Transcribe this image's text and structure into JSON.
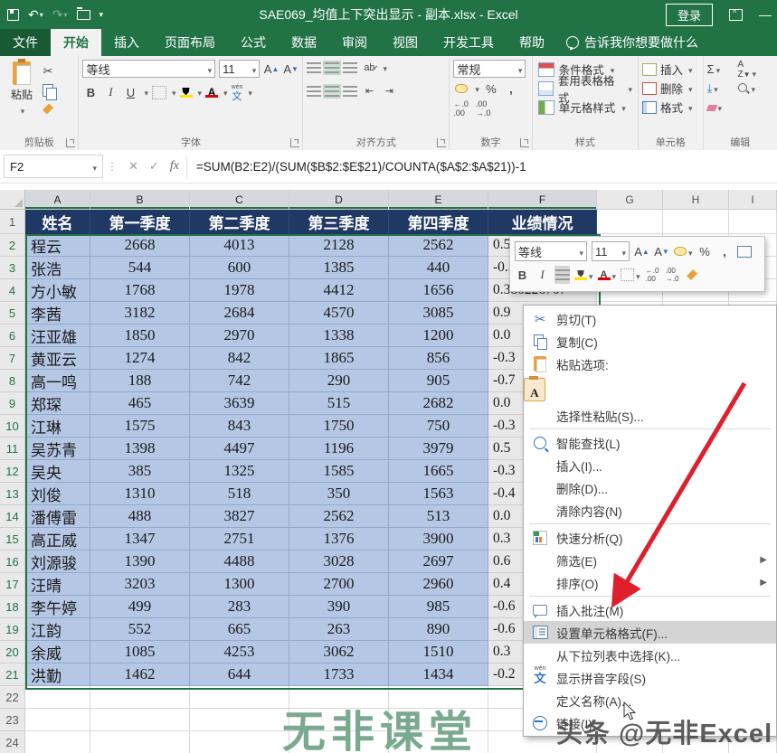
{
  "title_bar": {
    "title": "SAE069_均值上下突出显示 - 副本.xlsx  -  Excel",
    "login_label": "登录"
  },
  "tabs": {
    "items": [
      "文件",
      "开始",
      "插入",
      "页面布局",
      "公式",
      "数据",
      "审阅",
      "视图",
      "开发工具",
      "帮助"
    ],
    "active": "开始",
    "tell_me": "告诉我你想要做什么"
  },
  "ribbon": {
    "paste": "粘贴",
    "clipboard_group": "剪贴板",
    "font_group": "字体",
    "font_name": "等线",
    "font_size": "11",
    "bold": "B",
    "italic": "I",
    "underline": "U",
    "wen": "文",
    "align_group": "对齐方式",
    "number_group": "数字",
    "number_format": "常规",
    "percent": "%",
    "comma": ",",
    "styles_group": "样式",
    "cond_format": "条件格式",
    "table_format": "套用表格格式",
    "cell_styles": "单元格样式",
    "cells_group": "单元格",
    "insert": "插入",
    "delete": "删除",
    "format": "格式",
    "edit_group": "编辑",
    "sigma": "Σ"
  },
  "formula_bar": {
    "cell_ref": "F2",
    "formula": "=SUM(B2:E2)/(SUM($B$2:$E$21)/COUNTA($A$2:$A$21))-1"
  },
  "grid": {
    "column_letters": [
      "A",
      "B",
      "C",
      "D",
      "E",
      "F",
      "G",
      "H",
      "I"
    ],
    "headers": [
      "姓名",
      "第一季度",
      "第二季度",
      "第三季度",
      "第四季度",
      "业绩情况"
    ],
    "rows": [
      [
        "程云",
        "2668",
        "4013",
        "2128",
        "2562",
        "0.5"
      ],
      [
        "张浩",
        "544",
        "600",
        "1385",
        "440",
        "-0.5"
      ],
      [
        "方小敏",
        "1768",
        "1978",
        "4412",
        "1656",
        "0.380226707"
      ],
      [
        "李茜",
        "3182",
        "2684",
        "4570",
        "3085",
        "0.9"
      ],
      [
        "汪亚雄",
        "1850",
        "2970",
        "1338",
        "1200",
        "0.0"
      ],
      [
        "黄亚云",
        "1274",
        "842",
        "1865",
        "856",
        "-0.3"
      ],
      [
        "高一鸣",
        "188",
        "742",
        "290",
        "905",
        "-0.7"
      ],
      [
        "郑琛",
        "465",
        "3639",
        "515",
        "2682",
        "0.0"
      ],
      [
        "江琳",
        "1575",
        "843",
        "1750",
        "750",
        "-0.3"
      ],
      [
        "吴苏青",
        "1398",
        "4497",
        "1196",
        "3979",
        "0.5"
      ],
      [
        "吴央",
        "385",
        "1325",
        "1585",
        "1665",
        "-0.3"
      ],
      [
        "刘俊",
        "1310",
        "518",
        "350",
        "1563",
        "-0.4"
      ],
      [
        "潘傅雷",
        "488",
        "3827",
        "2562",
        "513",
        "0.0"
      ],
      [
        "高正威",
        "1347",
        "2751",
        "1376",
        "3900",
        "0.3"
      ],
      [
        "刘源骏",
        "1390",
        "4488",
        "3028",
        "2697",
        "0.6"
      ],
      [
        "汪晴",
        "3203",
        "1300",
        "2700",
        "2960",
        "0.4"
      ],
      [
        "李午婷",
        "499",
        "283",
        "390",
        "985",
        "-0.6"
      ],
      [
        "江韵",
        "552",
        "665",
        "263",
        "890",
        "-0.6"
      ],
      [
        "余威",
        "1085",
        "4253",
        "3062",
        "1510",
        "0.3"
      ],
      [
        "洪勤",
        "1462",
        "644",
        "1733",
        "1434",
        "-0.2"
      ]
    ]
  },
  "mini_toolbar": {
    "font_name": "等线",
    "font_size": "11",
    "bold": "B",
    "italic": "I",
    "font_color": "A",
    "percent": "%",
    "comma": ","
  },
  "context_menu": {
    "items": [
      {
        "icon": "scissors",
        "label": "剪切(T)"
      },
      {
        "icon": "copy",
        "label": "复制(C)"
      },
      {
        "icon": "paste",
        "label": "粘贴选项:"
      },
      {
        "type": "paste-option",
        "label": "A"
      },
      {
        "icon": "",
        "label": "选择性粘贴(S)..."
      },
      {
        "type": "separator"
      },
      {
        "icon": "lookup",
        "label": "智能查找(L)"
      },
      {
        "icon": "",
        "label": "插入(I)..."
      },
      {
        "icon": "",
        "label": "删除(D)..."
      },
      {
        "icon": "",
        "label": "清除内容(N)"
      },
      {
        "type": "separator"
      },
      {
        "icon": "quick",
        "label": "快速分析(Q)"
      },
      {
        "icon": "",
        "label": "筛选(E)",
        "submenu": true
      },
      {
        "icon": "",
        "label": "排序(O)",
        "submenu": true
      },
      {
        "type": "separator"
      },
      {
        "icon": "comment",
        "label": "插入批注(M)"
      },
      {
        "icon": "fmt",
        "label": "设置单元格格式(F)...",
        "highlighted": true
      },
      {
        "icon": "",
        "label": "从下拉列表中选择(K)..."
      },
      {
        "icon": "wen",
        "label": "显示拼音字段(S)"
      },
      {
        "icon": "",
        "label": "定义名称(A)..."
      },
      {
        "icon": "link",
        "label": "链接(I)"
      }
    ]
  },
  "watermark": {
    "center": "无非课堂",
    "bottom_right": "头条 @无非Excel"
  },
  "colors": {
    "excel_green": "#217346",
    "header_navy": "#1F3864",
    "selection_blue": "#B5C7E4",
    "arrow_red": "#E01F2D"
  }
}
